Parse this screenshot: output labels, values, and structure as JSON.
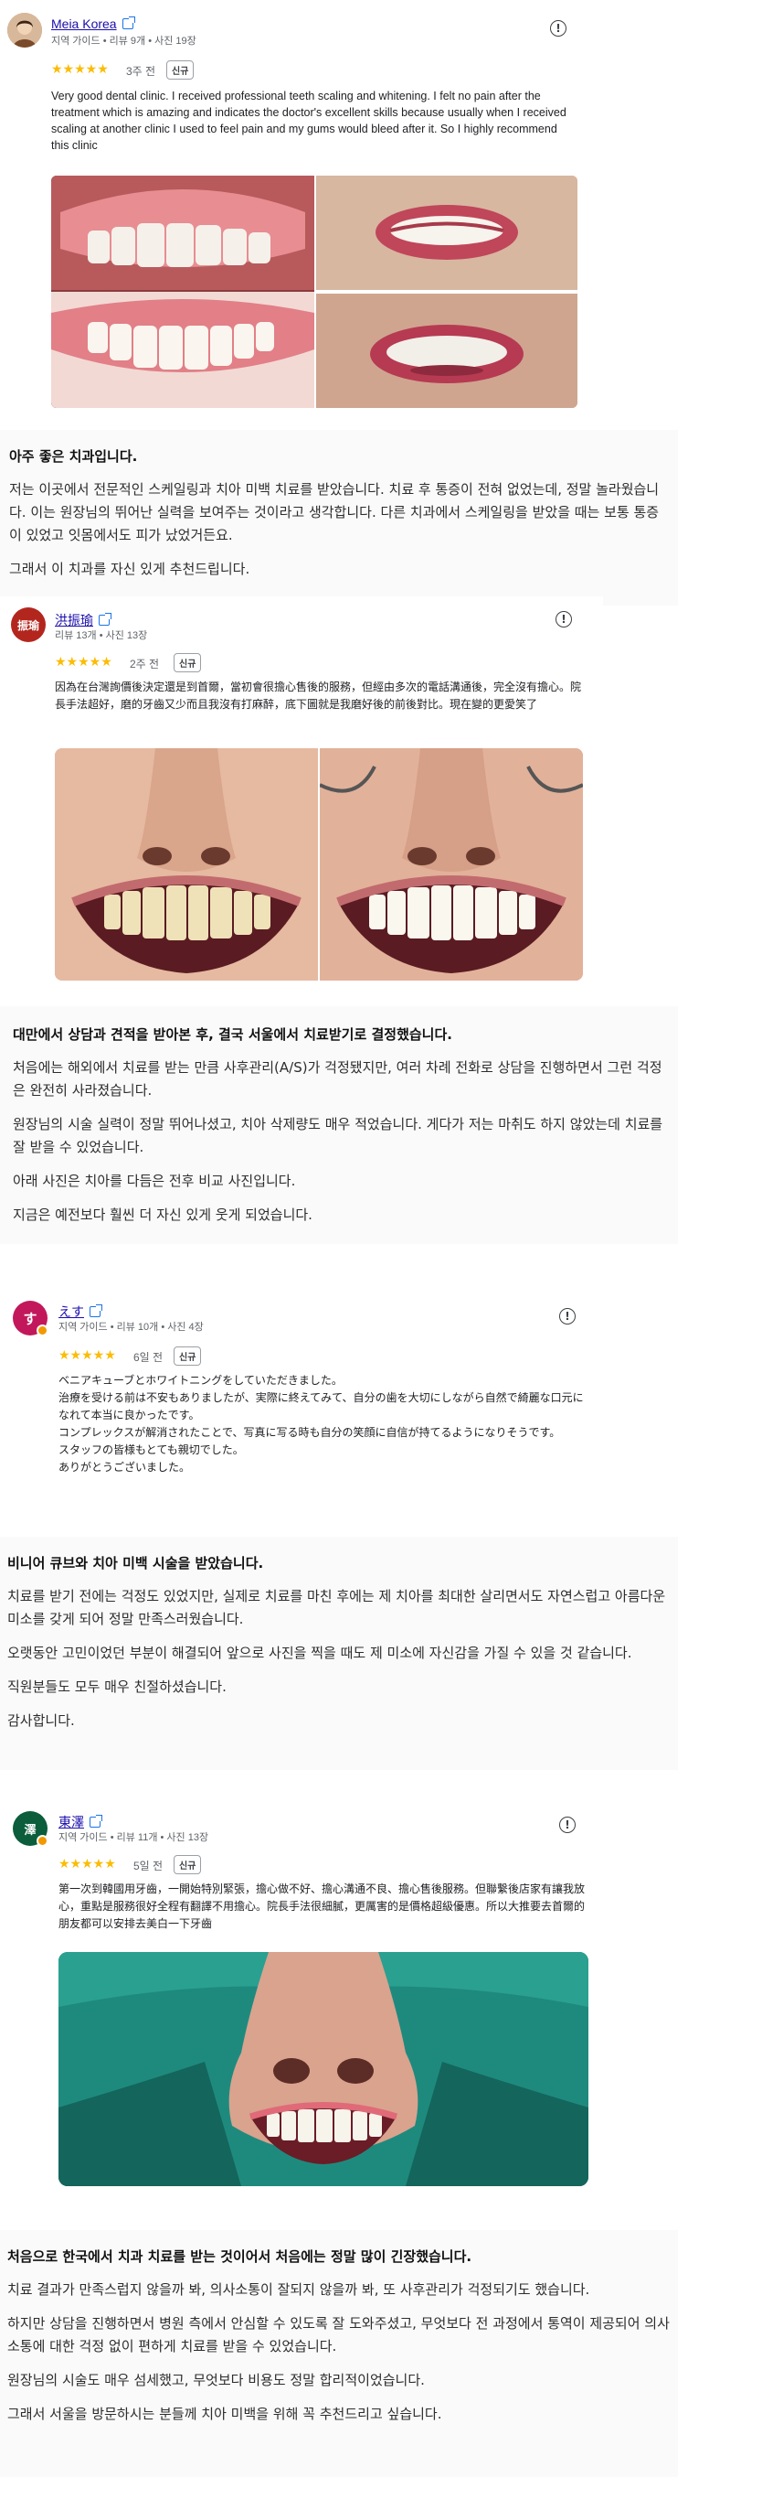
{
  "reviews": [
    {
      "name": "Meia Korea",
      "meta": "지역 가이드 • 리뷰 9개 • 사진 19장",
      "rating": 5,
      "stars": "★★★★★",
      "ago": "3주 전",
      "new_label": "신규",
      "text": "Very good dental clinic. I received professional teeth scaling and whitening. I felt no pain after the treatment which is amazing and indicates the doctor's excellent skills because usually when I received scaling at another clinic I used to feel pain and my gums would bleed after it. So I highly recommend this clinic"
    },
    {
      "name": "洪振瑜",
      "avatar_text": "振瑜",
      "meta": "리뷰 13개 • 사진 13장",
      "rating": 5,
      "stars": "★★★★★",
      "ago": "2주 전",
      "new_label": "신규",
      "text": "因為在台灣詢價後決定還是到首爾，當初會很擔心售後的服務，但經由多次的電話溝通後，完全沒有擔心。院長手法超好，磨的牙齒又少而且我沒有打麻醉，底下圖就是我磨好後的前後對比。現在變的更愛笑了"
    },
    {
      "name": "えす",
      "avatar_text": "す",
      "meta": "지역 가이드 • 리뷰 10개 • 사진 4장",
      "rating": 5,
      "stars": "★★★★★",
      "ago": "6일 전",
      "new_label": "신규",
      "text": "ベニアキューブとホワイトニングをしていただきました。\n治療を受ける前は不安もありましたが、実際に終えてみて、自分の歯を大切にしながら自然で綺麗な口元になれて本当に良かったです。\nコンプレックスが解消されたことで、写真に写る時も自分の笑顔に自信が持てるようになりそうです。\nスタッフの皆様もとても親切でした。\nありがとうございました。"
    },
    {
      "name": "東澤",
      "avatar_text": "澤",
      "meta": "지역 가이드 • 리뷰 11개 • 사진 13장",
      "rating": 5,
      "stars": "★★★★★",
      "ago": "5일 전",
      "new_label": "신규",
      "text": "第一次到韓國用牙齒，一開始特別緊張，擔心做不好、擔心溝通不良、擔心售後服務。但聯繫後店家有讓我放心，重點是服務很好全程有翻譯不用擔心。院長手法很細膩，更厲害的是價格超級優惠。所以大推要去首爾的朋友都可以安排去美白一下牙齒"
    }
  ],
  "translations": [
    {
      "title": "아주 좋은 치과입니다.",
      "paragraphs": [
        "저는 이곳에서 전문적인 스케일링과 치아 미백 치료를 받았습니다. 치료 후 통증이 전혀 없었는데, 정말 놀라웠습니다. 이는 원장님의 뛰어난 실력을 보여주는 것이라고 생각합니다. 다른 치과에서 스케일링을 받았을 때는 보통 통증이 있었고 잇몸에서도 피가 났었거든요.",
        "그래서 이 치과를 자신 있게 추천드립니다."
      ]
    },
    {
      "title": "대만에서 상담과 견적을 받아본 후, 결국 서울에서 치료받기로 결정했습니다.",
      "paragraphs": [
        "처음에는 해외에서 치료를 받는 만큼 사후관리(A/S)가 걱정됐지만, 여러 차례 전화로 상담을 진행하면서 그런 걱정은 완전히 사라졌습니다.",
        "원장님의 시술 실력이 정말 뛰어나셨고, 치아 삭제량도 매우 적었습니다. 게다가 저는 마취도 하지 않았는데 치료를 잘 받을 수 있었습니다.",
        "아래 사진은 치아를 다듬은 전후 비교 사진입니다.",
        "지금은 예전보다 훨씬 더 자신 있게 웃게 되었습니다."
      ]
    },
    {
      "title": "비니어 큐브와 치아 미백 시술을 받았습니다.",
      "paragraphs": [
        "치료를 받기 전에는 걱정도 있었지만, 실제로 치료를 마친 후에는 제 치아를 최대한 살리면서도 자연스럽고 아름다운 미소를 갖게 되어 정말 만족스러웠습니다.",
        "오랫동안 고민이었던 부분이 해결되어 앞으로 사진을 찍을 때도 제 미소에 자신감을 가질 수 있을 것 같습니다.",
        "직원분들도 모두 매우 친절하셨습니다.",
        "감사합니다."
      ]
    },
    {
      "title": "처음으로 한국에서 치과 치료를 받는 것이어서 처음에는 정말 많이 긴장했습니다.",
      "paragraphs": [
        "치료 결과가 만족스럽지 않을까 봐, 의사소통이 잘되지 않을까 봐, 또 사후관리가 걱정되기도 했습니다.",
        "하지만 상담을 진행하면서 병원 측에서 안심할 수 있도록 잘 도와주셨고, 무엇보다 전 과정에서 통역이 제공되어 의사소통에 대한 걱정 없이 편하게 치료를 받을 수 있었습니다.",
        "원장님의 시술도 매우 섬세했고, 무엇보다 비용도 정말 합리적이었습니다.",
        "그래서 서울을 방문하시는 분들께 치아 미백을 위해 꼭 추천드리고 싶습니다."
      ]
    }
  ],
  "icons": {
    "info": "info-circle-icon",
    "external": "external-link-icon",
    "star": "star-icon"
  },
  "colors": {
    "star": "#fbbc04",
    "link": "#1a0dab",
    "avatar2": "#b3261e",
    "avatar3": "#c2185b",
    "avatar4": "#0b5d3b"
  }
}
